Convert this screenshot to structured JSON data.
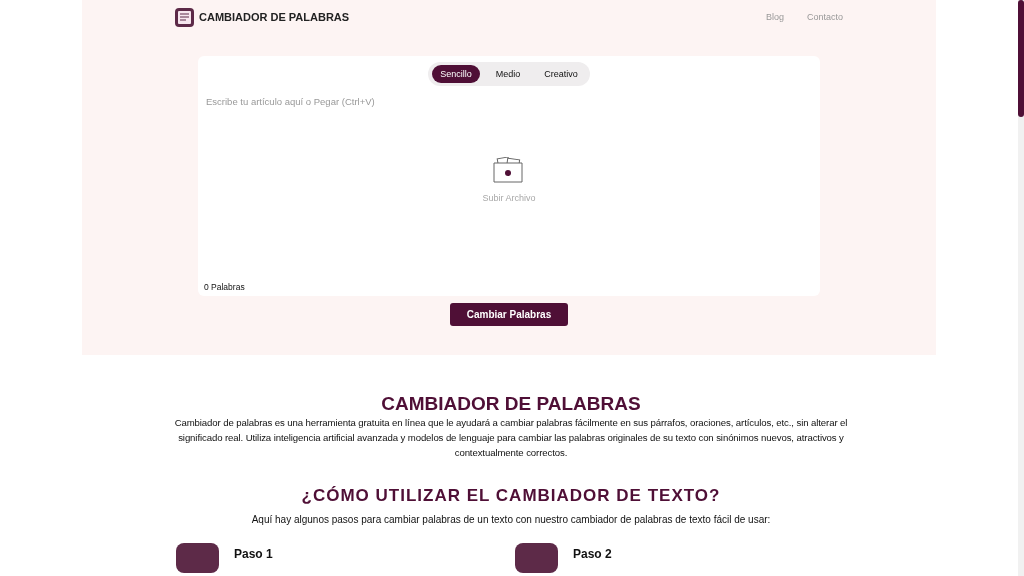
{
  "header": {
    "brand": "CAMBIADOR DE PALABRAS",
    "links": [
      "Blog",
      "Contacto"
    ]
  },
  "modes": [
    {
      "label": "Sencillo",
      "selected": true
    },
    {
      "label": "Medio",
      "selected": false
    },
    {
      "label": "Creativo",
      "selected": false
    }
  ],
  "editor": {
    "placeholder": "Escribe tu artículo aquí o Pegar (Ctrl+V)",
    "upload": "Subir Archivo",
    "word_count": "0 Palabras"
  },
  "submit": "Cambiar Palabras",
  "intro": {
    "title": "CAMBIADOR DE PALABRAS",
    "text": "Cambiador de palabras es una herramienta gratuita en línea que le ayudará a cambiar palabras fácilmente en sus párrafos, oraciones, artículos, etc., sin alterar el significado real. Utiliza inteligencia artificial avanzada y modelos de lenguaje para cambiar las palabras originales de su texto con sinónimos nuevos, atractivos y contextualmente correctos."
  },
  "howto": {
    "title": "¿CÓMO UTILIZAR EL CAMBIADOR DE TEXTO?",
    "text": "Aquí hay algunos pasos para cambiar palabras de un texto con nuestro cambiador de palabras de texto fácil de usar:"
  },
  "steps": [
    {
      "title": "Paso 1"
    },
    {
      "title": "Paso 2"
    }
  ]
}
